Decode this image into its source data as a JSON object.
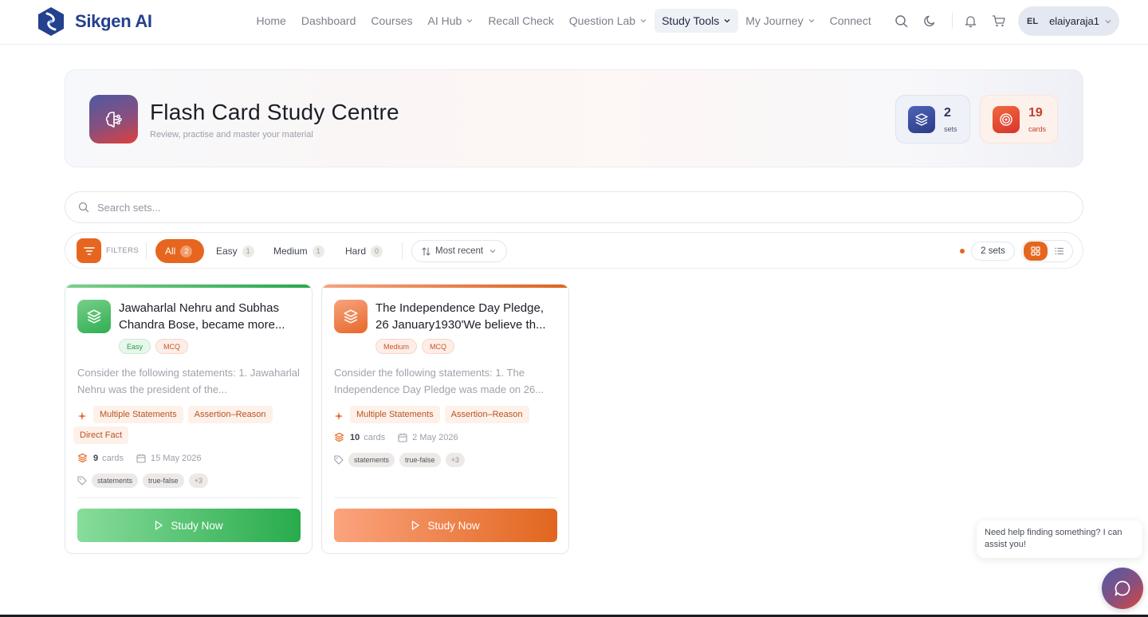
{
  "brand": {
    "name": "Sikgen AI",
    "color": "#24408e",
    "accent": "#e6661f"
  },
  "nav": {
    "items": [
      {
        "label": "Home",
        "dropdown": false
      },
      {
        "label": "Dashboard",
        "dropdown": false
      },
      {
        "label": "Courses",
        "dropdown": false
      },
      {
        "label": "AI Hub",
        "dropdown": true
      },
      {
        "label": "Recall Check",
        "dropdown": false
      },
      {
        "label": "Question Lab",
        "dropdown": true
      },
      {
        "label": "Study Tools",
        "dropdown": true,
        "active": true
      },
      {
        "label": "My Journey",
        "dropdown": true
      },
      {
        "label": "Connect",
        "dropdown": false
      }
    ],
    "icons": [
      "search-icon",
      "moon-icon",
      "bell-icon",
      "cart-icon"
    ],
    "user": {
      "initials": "EL",
      "name": "elaiyaraja1"
    }
  },
  "hero": {
    "title": "Flash Card Study Centre",
    "subtitle": "Review, practise and master your material",
    "stats": {
      "sets": {
        "value": "2",
        "label": "sets"
      },
      "cards": {
        "value": "19",
        "label": "cards"
      }
    }
  },
  "search": {
    "placeholder": "Search sets..."
  },
  "filters": {
    "label": "FILTERS",
    "chips": {
      "all": {
        "label": "All",
        "count": "2"
      },
      "easy": {
        "label": "Easy",
        "count": "1"
      },
      "medium": {
        "label": "Medium",
        "count": "1"
      },
      "hard": {
        "label": "Hard",
        "count": "0"
      }
    },
    "sort": "Most recent",
    "sets_count": "2 sets",
    "view": "grid"
  },
  "cards": [
    {
      "title": "Jawaharlal Nehru and Subhas Chandra Bose, became more...",
      "difficulty": "Easy",
      "format": "MCQ",
      "description": "Consider the following statements: 1. Jawaharlal Nehru was the president of the...",
      "question_types": [
        "Multiple Statements",
        "Assertion–Reason",
        "Direct Fact"
      ],
      "card_count": "9",
      "card_unit": "cards",
      "date": "15 May 2026",
      "labels": [
        "statements",
        "true-false",
        "+3"
      ],
      "cta": "Study Now",
      "theme": "#2fae52"
    },
    {
      "title": "The Independence Day Pledge, 26 January1930'We believe th...",
      "difficulty": "Medium",
      "format": "MCQ",
      "description": "Consider the following statements: 1. The Independence Day Pledge was made on 26...",
      "question_types": [
        "Multiple Statements",
        "Assertion–Reason"
      ],
      "card_count": "10",
      "card_unit": "cards",
      "date": "2 May 2026",
      "labels": [
        "statements",
        "true-false",
        "+3"
      ],
      "cta": "Study Now",
      "theme": "#e7682b"
    }
  ],
  "chat": {
    "message": "Need help finding something? I can assist you!"
  }
}
